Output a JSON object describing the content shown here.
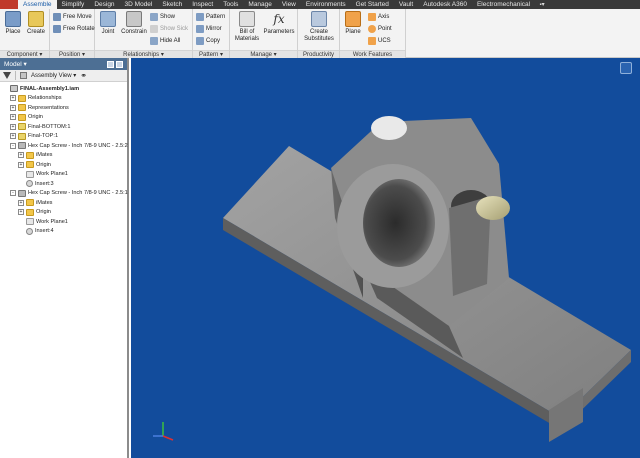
{
  "tabs": [
    "Assemble",
    "Simplify",
    "Design",
    "3D Model",
    "Sketch",
    "Inspect",
    "Tools",
    "Manage",
    "View",
    "Environments",
    "Get Started",
    "Vault",
    "Autodesk A360",
    "Electromechanical"
  ],
  "ribbon": {
    "component": {
      "label": "Component ▾",
      "place": "Place",
      "create": "Create"
    },
    "position": {
      "label": "Position ▾",
      "free_move": "Free Move",
      "free_rotate": "Free Rotate"
    },
    "relationships": {
      "label": "Relationships ▾",
      "joint": "Joint",
      "constrain": "Constrain",
      "show": "Show",
      "show_sick": "Show Sick",
      "hide_all": "Hide All"
    },
    "pattern": {
      "label": "Pattern ▾",
      "pattern": "Pattern",
      "mirror": "Mirror",
      "copy": "Copy"
    },
    "manage": {
      "label": "Manage ▾",
      "bom": "Bill of\nMaterials",
      "parameters": "Parameters"
    },
    "productivity": {
      "label": "Productivity",
      "create_subst": "Create\nSubstitutes"
    },
    "work_features": {
      "label": "Work Features",
      "plane": "Plane",
      "axis": "Axis",
      "point": "Point",
      "ucs": "UCS"
    }
  },
  "browser": {
    "title": "Model ▾",
    "view_mode": "Assembly View",
    "tree": [
      {
        "label": "FINAL-Assembly1.iam",
        "depth": 0,
        "icon": "asm",
        "exp": ""
      },
      {
        "label": "Relationships",
        "depth": 1,
        "icon": "folder",
        "exp": "+"
      },
      {
        "label": "Representations",
        "depth": 1,
        "icon": "folder",
        "exp": "+"
      },
      {
        "label": "Origin",
        "depth": 1,
        "icon": "folder",
        "exp": "+"
      },
      {
        "label": "Final-BOTTOM:1",
        "depth": 1,
        "icon": "part",
        "exp": "+"
      },
      {
        "label": "Final-TOP:1",
        "depth": 1,
        "icon": "part",
        "exp": "+"
      },
      {
        "label": "Hex Cap Screw - Inch 7/8-9 UNC - 2.5:2",
        "depth": 1,
        "icon": "bolt",
        "exp": "-"
      },
      {
        "label": "iMates",
        "depth": 2,
        "icon": "folder",
        "exp": "+"
      },
      {
        "label": "Origin",
        "depth": 2,
        "icon": "folder",
        "exp": "+"
      },
      {
        "label": "Work Plane1",
        "depth": 2,
        "icon": "plane",
        "exp": ""
      },
      {
        "label": "Insert:3",
        "depth": 2,
        "icon": "insert",
        "exp": ""
      },
      {
        "label": "Hex Cap Screw - Inch 7/8-9 UNC - 2.5:1",
        "depth": 1,
        "icon": "bolt",
        "exp": "-"
      },
      {
        "label": "iMates",
        "depth": 2,
        "icon": "folder",
        "exp": "+"
      },
      {
        "label": "Origin",
        "depth": 2,
        "icon": "folder",
        "exp": "+"
      },
      {
        "label": "Work Plane1",
        "depth": 2,
        "icon": "plane",
        "exp": ""
      },
      {
        "label": "Insert:4",
        "depth": 2,
        "icon": "insert",
        "exp": ""
      }
    ]
  },
  "colors": {
    "viewport_bg": "#124c9c",
    "part_face": "#8e8e8e",
    "accent": "#1b5da8"
  }
}
